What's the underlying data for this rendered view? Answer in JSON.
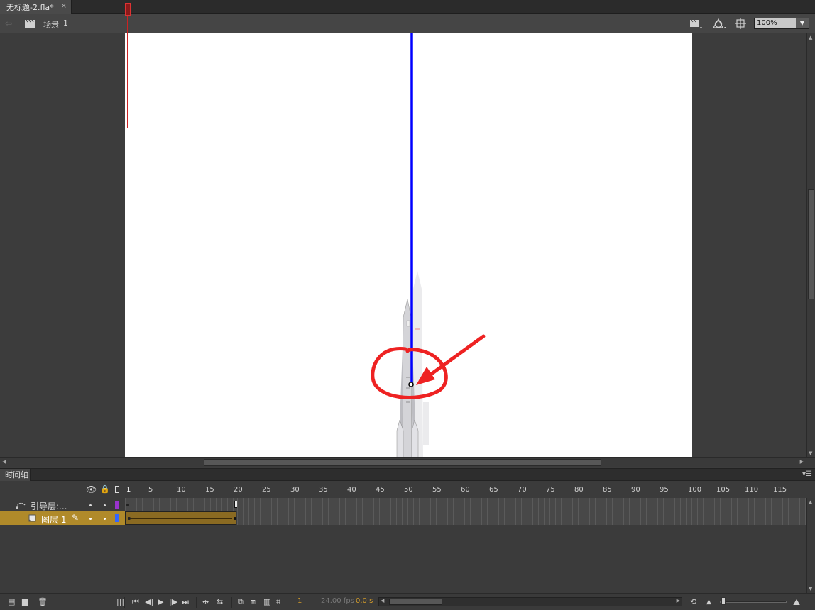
{
  "document_tab": {
    "title": "无标题-2.fla*",
    "close": "×"
  },
  "editbar": {
    "scene_label": "场景",
    "scene_number": "1",
    "zoom": "100%",
    "icons": [
      "back-arrow-icon",
      "scene-clapper-icon",
      "edit-scene-icon",
      "edit-symbols-icon",
      "center-stage-icon",
      "dropdown-arrow-icon"
    ]
  },
  "stage": {
    "background": "#ffffff",
    "motion_guide_color": "#0000ff",
    "annotation_color": "#ee2222",
    "object": "rocket"
  },
  "timeline": {
    "panel_title": "时间轴",
    "column_icons": [
      "eye-icon",
      "lock-icon",
      "outline-icon"
    ],
    "ruler_labels": [
      "1",
      "5",
      "10",
      "15",
      "20",
      "25",
      "30",
      "35",
      "40",
      "45",
      "50",
      "55",
      "60",
      "65",
      "70",
      "75",
      "80",
      "85",
      "90",
      "95",
      "100",
      "105",
      "110",
      "115"
    ],
    "layers": [
      {
        "name": "引导层:...",
        "type": "guide",
        "color": "#9933cc",
        "selected": false
      },
      {
        "name": "图层 1",
        "type": "normal",
        "color": "#3366ff",
        "selected": true
      }
    ],
    "tween_end_frame": 20,
    "current_frame": "1",
    "fps": "24.00 fps",
    "time": "0.0 s",
    "accent_color": "#d19a2a"
  }
}
